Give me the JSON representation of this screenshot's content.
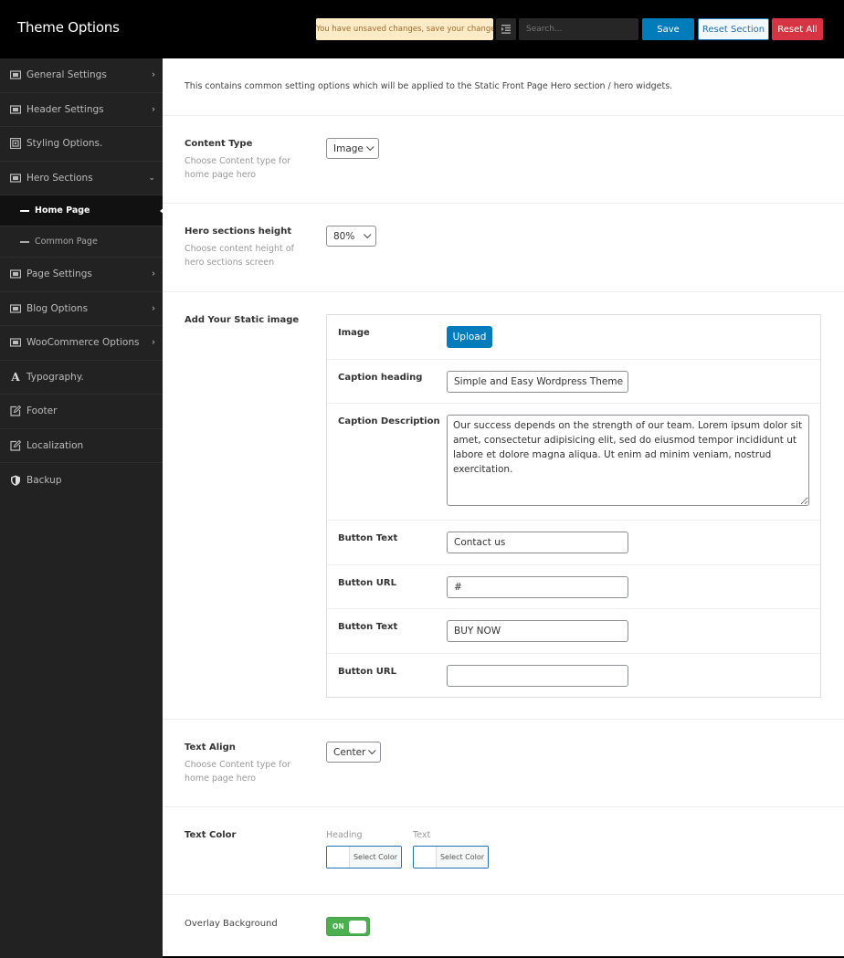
{
  "header": {
    "title": "Theme Options",
    "notice": "You have unsaved changes, save your changes!",
    "search_placeholder": "Search...",
    "save_label": "Save",
    "reset_section_label": "Reset Section",
    "reset_all_label": "Reset All"
  },
  "sidebar": {
    "items": [
      {
        "label": "General Settings",
        "icon": "panel-icon",
        "chevron": "›"
      },
      {
        "label": "Header Settings",
        "icon": "panel-icon",
        "chevron": "›"
      },
      {
        "label": "Styling Options.",
        "icon": "image-frame-icon"
      },
      {
        "label": "Hero Sections",
        "icon": "panel-icon",
        "chevron": "⌄",
        "expanded": true
      },
      {
        "label": "Page Settings",
        "icon": "panel-icon",
        "chevron": "›"
      },
      {
        "label": "Blog Options",
        "icon": "panel-icon",
        "chevron": "›"
      },
      {
        "label": "WooCommerce Options",
        "icon": "panel-icon",
        "chevron": "›"
      },
      {
        "label": "Typography.",
        "icon": "font-icon"
      },
      {
        "label": "Footer",
        "icon": "edit-icon"
      },
      {
        "label": "Localization",
        "icon": "edit-icon"
      },
      {
        "label": "Backup",
        "icon": "shield-icon"
      }
    ],
    "sub_items": [
      {
        "label": "Home Page",
        "active": true
      },
      {
        "label": "Common Page",
        "active": false
      }
    ]
  },
  "main": {
    "intro": "This contains common setting options which will be applied to the Static Front Page Hero section / hero widgets.",
    "content_type": {
      "label": "Content Type",
      "desc": "Choose Content type for home page hero",
      "value": "Image"
    },
    "hero_height": {
      "label": "Hero sections height",
      "desc": "Choose content height of hero sections screen",
      "value": "80%"
    },
    "static_image": {
      "label": "Add Your Static image",
      "image_label": "Image",
      "upload_label": "Upload",
      "caption_heading_label": "Caption heading",
      "caption_heading_value": "Simple and Easy Wordpress Theme",
      "caption_desc_label": "Caption Description",
      "caption_desc_value": "Our success depends on the strength of our team. Lorem ipsum dolor sit amet, consectetur adipisicing elit, sed do eiusmod tempor incididunt ut labore et dolore magna aliqua. Ut enim ad minim veniam, nostrud exercitation.",
      "button1_text_label": "Button Text",
      "button1_text_value": "Contact us",
      "button1_url_label": "Button URL",
      "button1_url_value": "#",
      "button2_text_label": "Button Text",
      "button2_text_value": "BUY NOW",
      "button2_url_label": "Button URL",
      "button2_url_value": ""
    },
    "text_align": {
      "label": "Text Align",
      "desc": "Choose Content type for home page hero",
      "value": "Center"
    },
    "text_color": {
      "label": "Text Color",
      "heading_label": "Heading",
      "text_label": "Text",
      "select_label": "Select Color"
    },
    "overlay": {
      "label": "Overlay Background",
      "state": "ON"
    }
  }
}
